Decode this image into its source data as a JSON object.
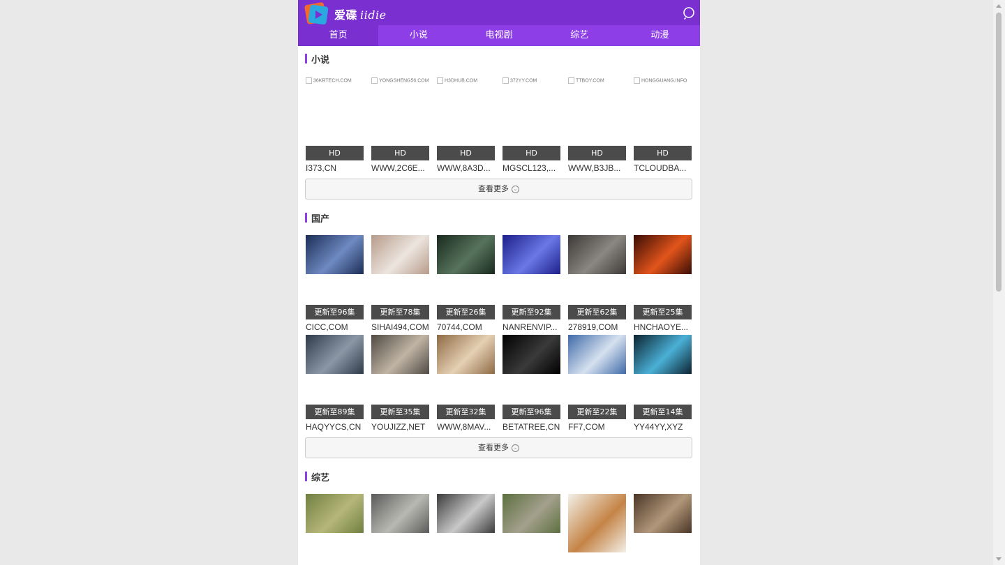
{
  "header": {
    "logo_cn": "爱碟",
    "logo_en": "iidie",
    "colors": {
      "topbar": "#7a2fd0",
      "nav": "#8e3ee6"
    }
  },
  "nav": [
    "首页",
    "小说",
    "电视剧",
    "综艺",
    "动漫"
  ],
  "sections": [
    {
      "title": "小说",
      "items": [
        {
          "alt": "36KRTECH.COM",
          "badge": "HD",
          "name": "I373,CN"
        },
        {
          "alt": "YONGSHENG56.COM",
          "badge": "HD",
          "name": "WWW,2C6E..."
        },
        {
          "alt": "H3DHUB.COM",
          "badge": "HD",
          "name": "WWW,8A3D..."
        },
        {
          "alt": "372YY.COM",
          "badge": "HD",
          "name": "MGSCL123,..."
        },
        {
          "alt": "TTBOY.COM",
          "badge": "HD",
          "name": "WWW,B3JB..."
        },
        {
          "alt": "HONGGUANG.INFO",
          "badge": "HD",
          "name": "TCLOUDBA..."
        }
      ],
      "more": "查看更多"
    },
    {
      "title": "国产",
      "items": [
        {
          "badge": "更新至96集",
          "name": "CICC,COM",
          "img": [
            "#1c2d55",
            "#6e8ac2"
          ]
        },
        {
          "badge": "更新至78集",
          "name": "SIHAI494,COM",
          "img": [
            "#b79b8a",
            "#ece5df"
          ]
        },
        {
          "badge": "更新至26集",
          "name": "70744,COM",
          "img": [
            "#1a2a1e",
            "#56735c"
          ]
        },
        {
          "badge": "更新至92集",
          "name": "NANRENVIP...",
          "img": [
            "#1c1f8a",
            "#6a78e6"
          ]
        },
        {
          "badge": "更新至62集",
          "name": "278919,COM",
          "img": [
            "#3c3a38",
            "#8a8680"
          ]
        },
        {
          "badge": "更新至25集",
          "name": "HNCHAOYE...",
          "img": [
            "#3a0d05",
            "#e2541b"
          ]
        },
        {
          "badge": "更新至89集",
          "name": "HAQYYCS,CN",
          "img": [
            "#2e3a4a",
            "#8c97a6"
          ]
        },
        {
          "badge": "更新至35集",
          "name": "YOUJIZZ,NET",
          "img": [
            "#4f4a44",
            "#c0b4a4"
          ]
        },
        {
          "badge": "更新至32集",
          "name": "WWW,8MAV...",
          "img": [
            "#8e6a45",
            "#e5d0b3"
          ]
        },
        {
          "badge": "更新至96集",
          "name": "BETATREE,CN",
          "img": [
            "#000000",
            "#3a3a3a"
          ]
        },
        {
          "badge": "更新至22集",
          "name": "FF7,COM",
          "img": [
            "#3f6aa8",
            "#d6e1ef"
          ]
        },
        {
          "badge": "更新至14集",
          "name": "YY44YY,XYZ",
          "img": [
            "#0c2230",
            "#4ab0d6"
          ]
        }
      ],
      "more": "查看更多"
    },
    {
      "title": "综艺",
      "items": [
        {
          "img": [
            "#6f8040",
            "#b6b67a"
          ]
        },
        {
          "img": [
            "#5a5a5a",
            "#b9b9b3"
          ]
        },
        {
          "img": [
            "#3c3c3c",
            "#c9c9c9"
          ]
        },
        {
          "img": [
            "#5c7040",
            "#a4a08c"
          ]
        },
        {
          "img": [
            "#f3f0e8",
            "#c58447"
          ]
        },
        {
          "img": [
            "#4a3526",
            "#b2987a"
          ]
        }
      ]
    }
  ]
}
